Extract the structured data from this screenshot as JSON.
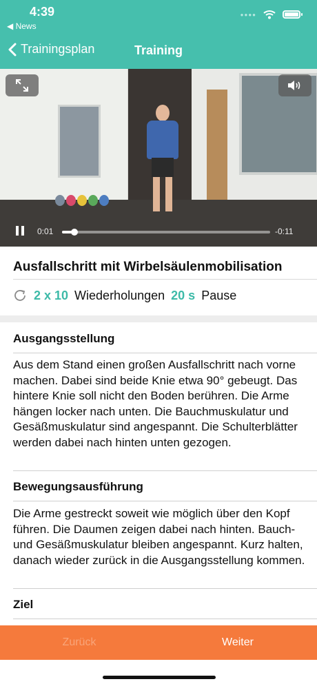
{
  "status_bar": {
    "time": "4:39",
    "back_app": "◀ News"
  },
  "nav": {
    "back_label": "Trainingsplan",
    "title": "Training"
  },
  "video": {
    "elapsed": "0:01",
    "remaining": "-0:11",
    "progress": 0.06
  },
  "exercise": {
    "title": "Ausfallschritt mit Wirbelsäulenmobilisation",
    "sets": "2 x 10",
    "reps_label": "Wiederholungen",
    "pause_value": "20 s",
    "pause_label": "Pause"
  },
  "sections": {
    "start_heading": "Ausgangsstellung",
    "start_text": "Aus dem Stand einen großen Ausfallschritt nach vorne machen. Dabei sind beide Knie etwa 90° gebeugt. Das hintere Knie soll nicht den Boden berühren. Die Arme hängen locker nach unten. Die Bauchmuskulatur und Gesäßmuskulatur sind angespannt. Die Schulterblätter werden dabei nach hinten unten gezogen.",
    "movement_heading": "Bewegungsausführung",
    "movement_text": "Die Arme gestreckt soweit wie möglich über den Kopf führen. Die Daumen zeigen dabei nach hinten. Bauch- und Gesäßmuskulatur bleiben angespannt. Kurz halten, danach wieder zurück in die Ausgangsstellung kommen.",
    "goal_heading": "Ziel"
  },
  "bottom_bar": {
    "back_label": "Zurück",
    "next_label": "Weiter"
  },
  "colors": {
    "header": "#46bfad",
    "accent": "#3dbaa8",
    "bottom_bar": "#f57a3c"
  }
}
